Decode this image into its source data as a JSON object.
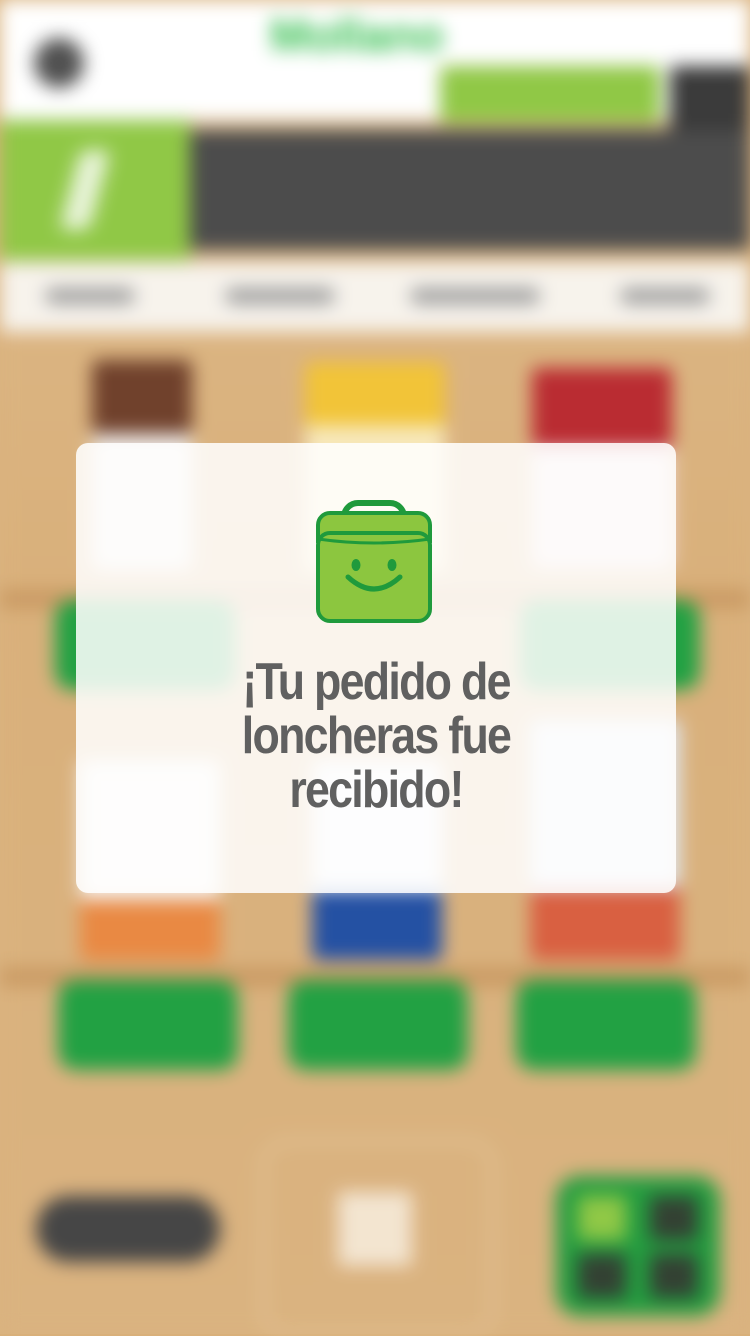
{
  "background_app": {
    "logo_text": "Mollano",
    "colors": {
      "brand_green": "#2fbd4a",
      "accent_green": "#8cc63f",
      "button_green": "#1a9e3c",
      "shelf": "#d9b07a"
    }
  },
  "modal": {
    "icon": "smiling-shopping-bag-icon",
    "title": "¡Tu pedido de loncheras fue recibido!"
  }
}
